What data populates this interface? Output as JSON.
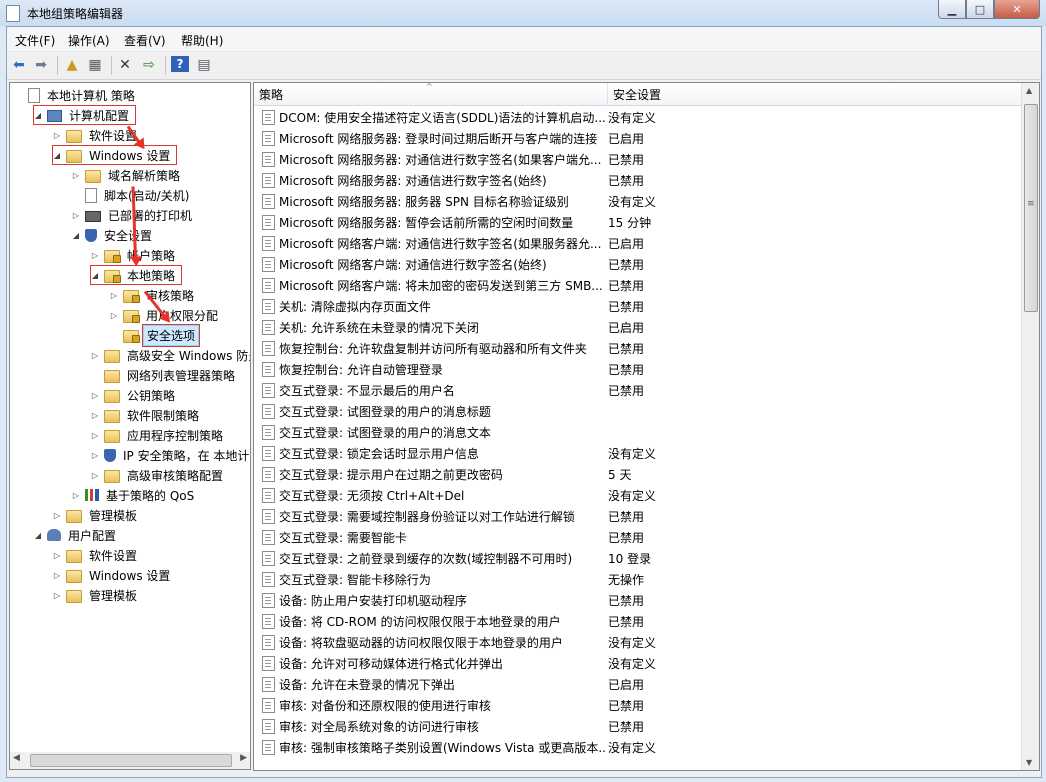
{
  "window": {
    "title": "本地组策略编辑器",
    "minimize": "▁",
    "maximize": "□",
    "close": "✕"
  },
  "menu": [
    "文件(F)",
    "操作(A)",
    "查看(V)",
    "帮助(H)"
  ],
  "toolbar_icons": [
    "back-icon",
    "forward-icon",
    "up-folder-icon",
    "show-hide-tree-icon",
    "delete-icon",
    "export-list-icon",
    "help-icon",
    "properties-icon"
  ],
  "tree": [
    {
      "label": "本地计算机 策略",
      "level": 0,
      "icon": "doc",
      "exp": ""
    },
    {
      "label": "计算机配置",
      "level": 1,
      "icon": "pc",
      "exp": "◢",
      "boxed": true
    },
    {
      "label": "软件设置",
      "level": 2,
      "icon": "folder",
      "exp": "▷"
    },
    {
      "label": "Windows 设置",
      "level": 2,
      "icon": "folder",
      "exp": "◢",
      "boxed": true
    },
    {
      "label": "域名解析策略",
      "level": 3,
      "icon": "folder",
      "exp": "▷"
    },
    {
      "label": "脚本(启动/关机)",
      "level": 3,
      "icon": "doc",
      "exp": ""
    },
    {
      "label": "已部署的打印机",
      "level": 3,
      "icon": "printer",
      "exp": "▷"
    },
    {
      "label": "安全设置",
      "level": 3,
      "icon": "shield",
      "exp": "◢"
    },
    {
      "label": "帐户策略",
      "level": 4,
      "icon": "lockfolder",
      "exp": "▷"
    },
    {
      "label": "本地策略",
      "level": 4,
      "icon": "lockfolder",
      "exp": "◢",
      "boxed": true
    },
    {
      "label": "审核策略",
      "level": 5,
      "icon": "lockfolder",
      "exp": "▷"
    },
    {
      "label": "用户权限分配",
      "level": 5,
      "icon": "lockfolder",
      "exp": "▷"
    },
    {
      "label": "安全选项",
      "level": 5,
      "icon": "lockfolder",
      "exp": "",
      "boxed": true,
      "selected": true
    },
    {
      "label": "高级安全 Windows 防火墙",
      "level": 4,
      "icon": "folder",
      "exp": "▷"
    },
    {
      "label": "网络列表管理器策略",
      "level": 4,
      "icon": "folder",
      "exp": ""
    },
    {
      "label": "公钥策略",
      "level": 4,
      "icon": "folder",
      "exp": "▷"
    },
    {
      "label": "软件限制策略",
      "level": 4,
      "icon": "folder",
      "exp": "▷"
    },
    {
      "label": "应用程序控制策略",
      "level": 4,
      "icon": "folder",
      "exp": "▷"
    },
    {
      "label": "IP 安全策略，在 本地计算机",
      "level": 4,
      "icon": "shield",
      "exp": "▷"
    },
    {
      "label": "高级审核策略配置",
      "level": 4,
      "icon": "folder",
      "exp": "▷"
    },
    {
      "label": "基于策略的 QoS",
      "level": 3,
      "icon": "chart",
      "exp": "▷"
    },
    {
      "label": "管理模板",
      "level": 2,
      "icon": "folder",
      "exp": "▷"
    },
    {
      "label": "用户配置",
      "level": 1,
      "icon": "users",
      "exp": "◢"
    },
    {
      "label": "软件设置",
      "level": 2,
      "icon": "folder",
      "exp": "▷"
    },
    {
      "label": "Windows 设置",
      "level": 2,
      "icon": "folder",
      "exp": "▷"
    },
    {
      "label": "管理模板",
      "level": 2,
      "icon": "folder",
      "exp": "▷"
    }
  ],
  "columns": {
    "policy": "策略",
    "setting": "安全设置"
  },
  "policies": [
    {
      "name": "DCOM: 使用安全描述符定义语言(SDDL)语法的计算机启动...",
      "setting": "没有定义"
    },
    {
      "name": "Microsoft 网络服务器: 登录时间过期后断开与客户端的连接",
      "setting": "已启用"
    },
    {
      "name": "Microsoft 网络服务器: 对通信进行数字签名(如果客户端允...",
      "setting": "已禁用"
    },
    {
      "name": "Microsoft 网络服务器: 对通信进行数字签名(始终)",
      "setting": "已禁用"
    },
    {
      "name": "Microsoft 网络服务器: 服务器 SPN 目标名称验证级别",
      "setting": "没有定义"
    },
    {
      "name": "Microsoft 网络服务器: 暂停会话前所需的空闲时间数量",
      "setting": "15 分钟"
    },
    {
      "name": "Microsoft 网络客户端: 对通信进行数字签名(如果服务器允...",
      "setting": "已启用"
    },
    {
      "name": "Microsoft 网络客户端: 对通信进行数字签名(始终)",
      "setting": "已禁用"
    },
    {
      "name": "Microsoft 网络客户端: 将未加密的密码发送到第三方 SMB...",
      "setting": "已禁用"
    },
    {
      "name": "关机: 清除虚拟内存页面文件",
      "setting": "已禁用"
    },
    {
      "name": "关机: 允许系统在未登录的情况下关闭",
      "setting": "已启用"
    },
    {
      "name": "恢复控制台: 允许软盘复制并访问所有驱动器和所有文件夹",
      "setting": "已禁用"
    },
    {
      "name": "恢复控制台: 允许自动管理登录",
      "setting": "已禁用"
    },
    {
      "name": "交互式登录: 不显示最后的用户名",
      "setting": "已禁用"
    },
    {
      "name": "交互式登录: 试图登录的用户的消息标题",
      "setting": ""
    },
    {
      "name": "交互式登录: 试图登录的用户的消息文本",
      "setting": ""
    },
    {
      "name": "交互式登录: 锁定会话时显示用户信息",
      "setting": "没有定义"
    },
    {
      "name": "交互式登录: 提示用户在过期之前更改密码",
      "setting": "5 天"
    },
    {
      "name": "交互式登录: 无须按 Ctrl+Alt+Del",
      "setting": "没有定义"
    },
    {
      "name": "交互式登录: 需要域控制器身份验证以对工作站进行解锁",
      "setting": "已禁用"
    },
    {
      "name": "交互式登录: 需要智能卡",
      "setting": "已禁用"
    },
    {
      "name": "交互式登录: 之前登录到缓存的次数(域控制器不可用时)",
      "setting": "10 登录"
    },
    {
      "name": "交互式登录: 智能卡移除行为",
      "setting": "无操作"
    },
    {
      "name": "设备: 防止用户安装打印机驱动程序",
      "setting": "已禁用"
    },
    {
      "name": "设备: 将 CD-ROM 的访问权限仅限于本地登录的用户",
      "setting": "已禁用"
    },
    {
      "name": "设备: 将软盘驱动器的访问权限仅限于本地登录的用户",
      "setting": "没有定义"
    },
    {
      "name": "设备: 允许对可移动媒体进行格式化并弹出",
      "setting": "没有定义"
    },
    {
      "name": "设备: 允许在未登录的情况下弹出",
      "setting": "已启用"
    },
    {
      "name": "审核: 对备份和还原权限的使用进行审核",
      "setting": "已禁用"
    },
    {
      "name": "审核: 对全局系统对象的访问进行审核",
      "setting": "已禁用"
    },
    {
      "name": "审核: 强制审核策略子类别设置(Windows Vista 或更高版本...",
      "setting": "没有定义"
    }
  ],
  "scroll": {
    "up": "▲",
    "down": "▼",
    "left": "◀",
    "right": "▶",
    "grip": "≡"
  }
}
